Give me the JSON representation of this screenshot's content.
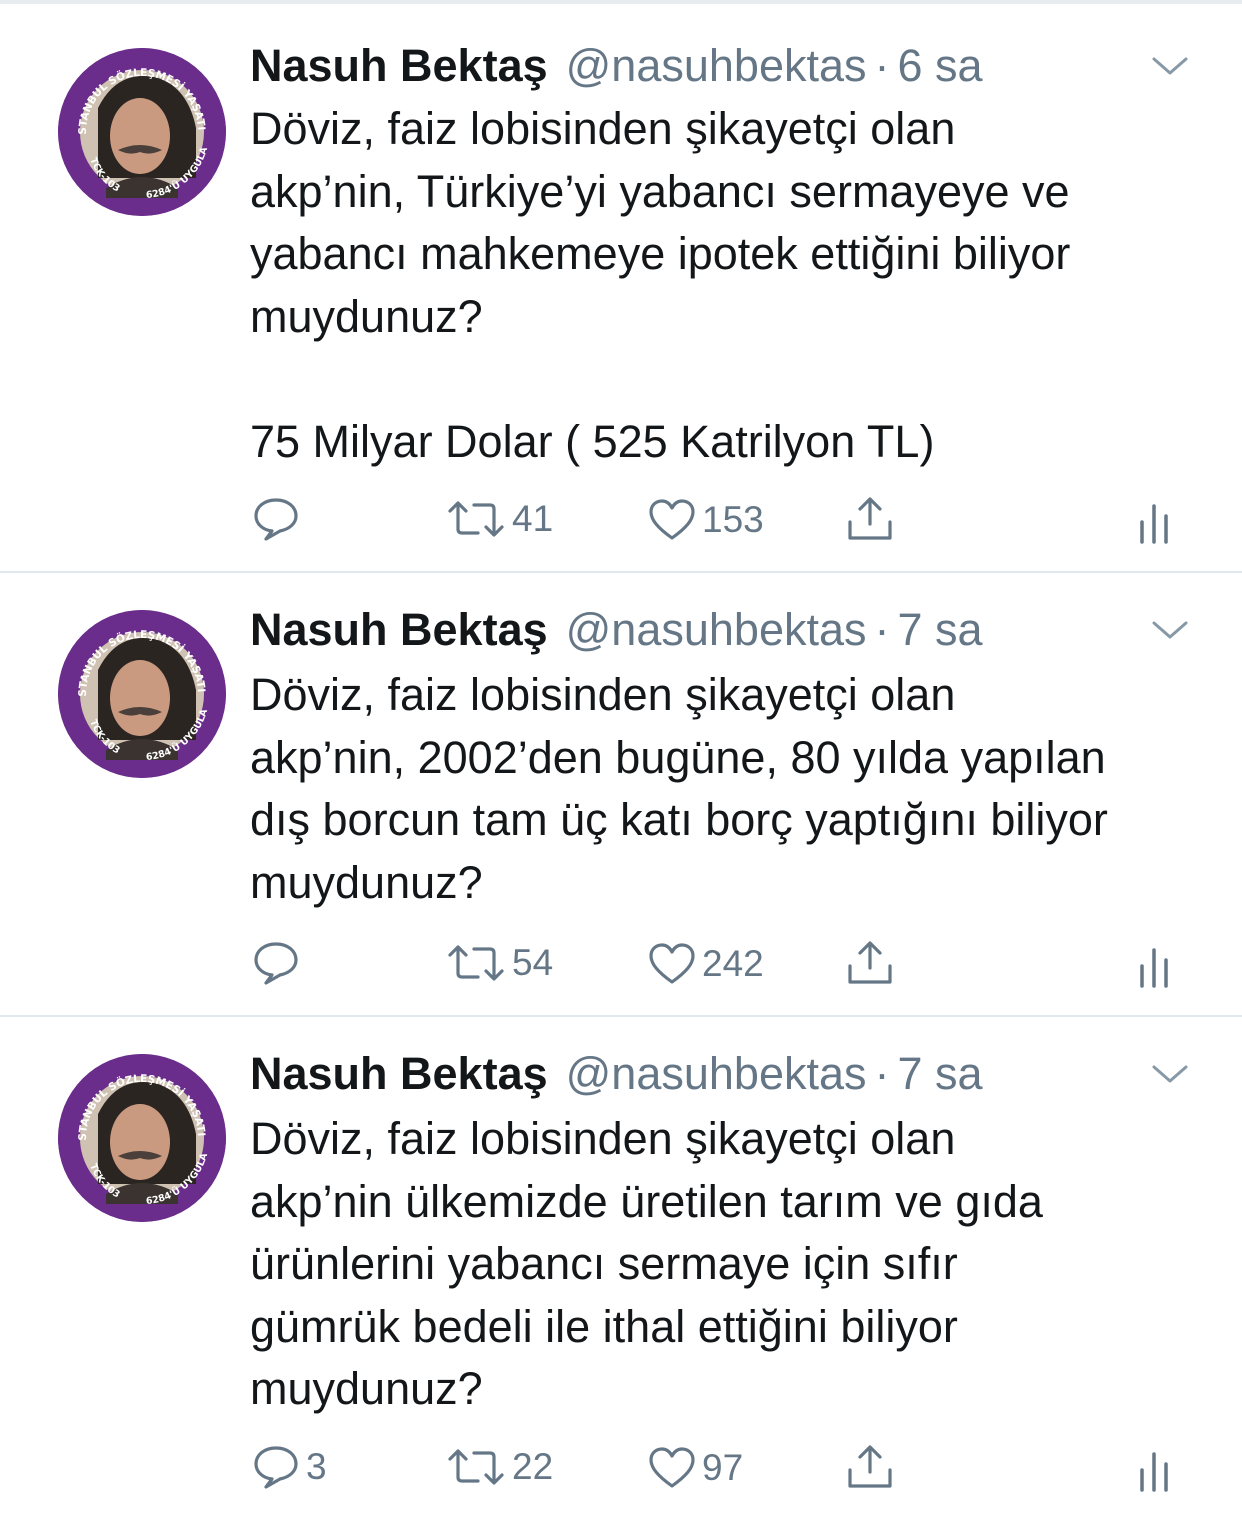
{
  "tweets": [
    {
      "author": {
        "name": "Nasuh Bektaş",
        "handle": "@nasuhbektas",
        "avatar_ring_top": "İSTANBUL SÖZLEŞMESİ YAŞATIR",
        "avatar_ring_left": "TCK-103",
        "avatar_ring_right": "6284'Ü UYGULA"
      },
      "separator": "·",
      "time": "6 sa",
      "text": "Döviz, faiz lobisinden şikayetçi olan\nakp’nin, Türkiye’yi yabancı sermayeye ve\nyabancı mahkemeye ipotek ettiğini biliyor\nmuydunuz?\n\n75 Milyar Dolar ( 525 Katrilyon TL)",
      "replies": "",
      "retweets": "41",
      "likes": "153"
    },
    {
      "author": {
        "name": "Nasuh Bektaş",
        "handle": "@nasuhbektas",
        "avatar_ring_top": "İSTANBUL SÖZLEŞMESİ YAŞATIR",
        "avatar_ring_left": "TCK-103",
        "avatar_ring_right": "6284'Ü UYGULA"
      },
      "separator": "·",
      "time": "7 sa",
      "text": "Döviz, faiz lobisinden şikayetçi olan\nakp’nin, 2002’den bugüne, 80 yılda yapılan\ndış borcun tam üç katı borç yaptığını biliyor\nmuydunuz?",
      "replies": "",
      "retweets": "54",
      "likes": "242"
    },
    {
      "author": {
        "name": "Nasuh Bektaş",
        "handle": "@nasuhbektas",
        "avatar_ring_top": "İSTANBUL SÖZLEŞMESİ YAŞATIR",
        "avatar_ring_left": "TCK-103",
        "avatar_ring_right": "6284'Ü UYGULA"
      },
      "separator": "·",
      "time": "7 sa",
      "text": "Döviz, faiz lobisinden şikayetçi olan\nakp’nin ülkemizde üretilen tarım ve gıda\nürünlerini yabancı sermaye için sıfır\ngümrük bedeli ile ithal ettiğini biliyor\nmuydunuz?",
      "replies": "3",
      "retweets": "22",
      "likes": "97"
    }
  ],
  "icons": {
    "reply": "speech-bubble-icon",
    "retweet": "retweet-arrows-icon",
    "like": "heart-outline-icon",
    "share": "share-upload-icon",
    "analytics": "analytics-bars-icon",
    "more": "chevron-down-icon"
  },
  "colors": {
    "text": "#14171a",
    "secondary": "#657786",
    "divider": "#e1e8ed",
    "avatar_ring": "#6a2d8c"
  }
}
